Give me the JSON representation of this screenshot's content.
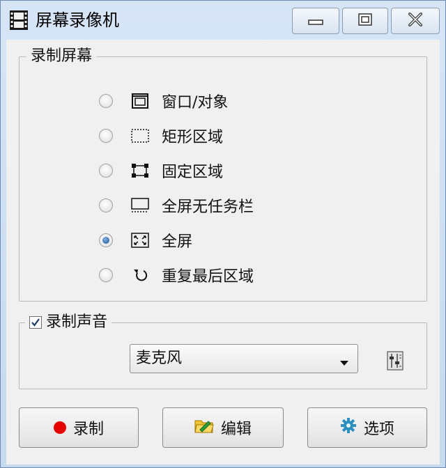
{
  "window": {
    "title": "屏幕录像机",
    "controls": {
      "minimize": "minimize",
      "maximize": "maximize",
      "close": "close"
    }
  },
  "record_screen": {
    "group_label": "录制屏幕",
    "options": [
      {
        "label": "窗口/对象",
        "icon": "window-object-icon",
        "selected": false
      },
      {
        "label": "矩形区域",
        "icon": "dotted-rectangle-icon",
        "selected": false
      },
      {
        "label": "固定区域",
        "icon": "fixed-region-icon",
        "selected": false
      },
      {
        "label": "全屏无任务栏",
        "icon": "fullscreen-no-taskbar-icon",
        "selected": false
      },
      {
        "label": "全屏",
        "icon": "fullscreen-icon",
        "selected": true
      },
      {
        "label": "重复最后区域",
        "icon": "repeat-arrow-icon",
        "selected": false
      }
    ]
  },
  "record_audio": {
    "group_label": "录制声音",
    "checked": true,
    "device": "麦克风"
  },
  "buttons": {
    "record": "录制",
    "edit": "编辑",
    "options": "选项"
  },
  "colors": {
    "record_dot": "#e60000",
    "selected_radio": "#1c4f86"
  }
}
